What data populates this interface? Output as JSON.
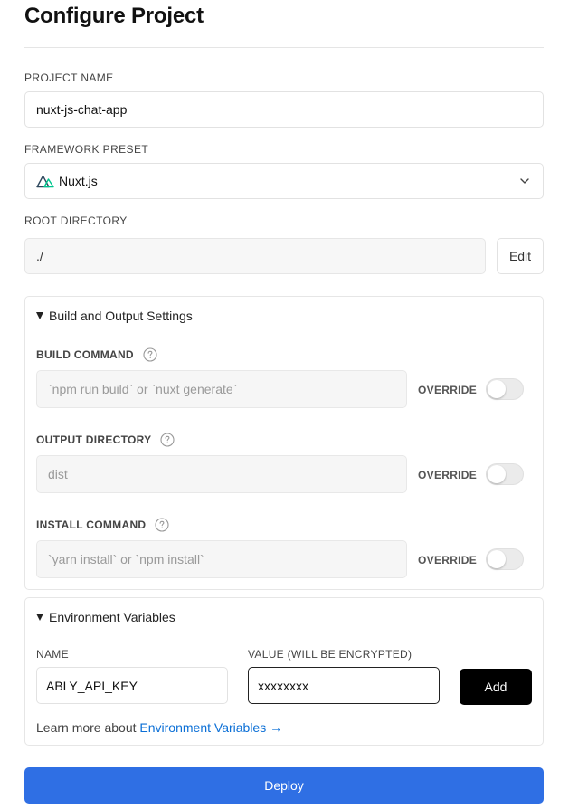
{
  "page": {
    "title": "Configure Project"
  },
  "project_name": {
    "label": "PROJECT NAME",
    "value": "nuxt-js-chat-app"
  },
  "framework_preset": {
    "label": "FRAMEWORK PRESET",
    "value": "Nuxt.js",
    "icon": "nuxt-logo-icon"
  },
  "root_directory": {
    "label": "ROOT DIRECTORY",
    "value": "./",
    "edit_label": "Edit"
  },
  "build_settings": {
    "title": "Build and Output Settings",
    "build_command": {
      "label": "BUILD COMMAND",
      "placeholder": "`npm run build` or `nuxt generate`",
      "override_label": "OVERRIDE",
      "override_enabled": false
    },
    "output_directory": {
      "label": "OUTPUT DIRECTORY",
      "placeholder": "dist",
      "override_label": "OVERRIDE",
      "override_enabled": false
    },
    "install_command": {
      "label": "INSTALL COMMAND",
      "placeholder": "`yarn install` or `npm install`",
      "override_label": "OVERRIDE",
      "override_enabled": false
    }
  },
  "env_vars": {
    "title": "Environment Variables",
    "name_label": "NAME",
    "value_label": "VALUE (WILL BE ENCRYPTED)",
    "name_value": "ABLY_API_KEY",
    "value_value": "xxxxxxxx",
    "add_label": "Add",
    "learn_more_prefix": "Learn more about ",
    "learn_more_link": "Environment Variables →"
  },
  "deploy": {
    "label": "Deploy"
  },
  "colors": {
    "accent": "#2f6fe4",
    "link": "#0b6fd6",
    "nuxt_green": "#00c58e",
    "nuxt_dark": "#2f495e"
  }
}
